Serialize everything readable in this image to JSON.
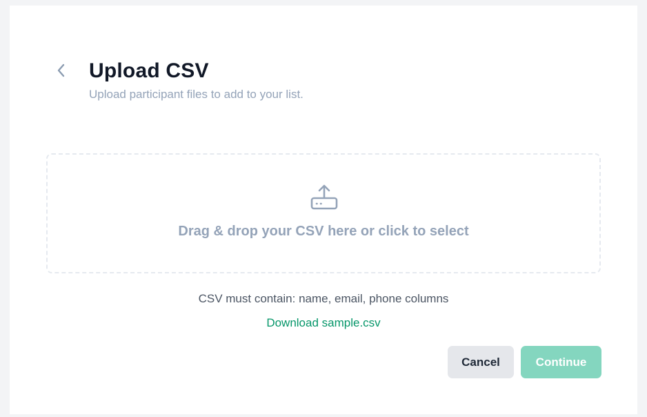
{
  "header": {
    "title": "Upload CSV",
    "subtitle": "Upload participant files to add to your list."
  },
  "dropzone": {
    "text": "Drag & drop your CSV here or click to select",
    "icon": "upload-icon"
  },
  "info": {
    "requirements": "CSV must contain: name, email, phone columns",
    "sample_link": "Download sample.csv"
  },
  "actions": {
    "cancel_label": "Cancel",
    "continue_label": "Continue",
    "continue_enabled": false
  },
  "colors": {
    "accent": "#059669",
    "continue_disabled_bg": "#84d6bf",
    "muted_text": "#94a3b8",
    "title_text": "#111827"
  }
}
